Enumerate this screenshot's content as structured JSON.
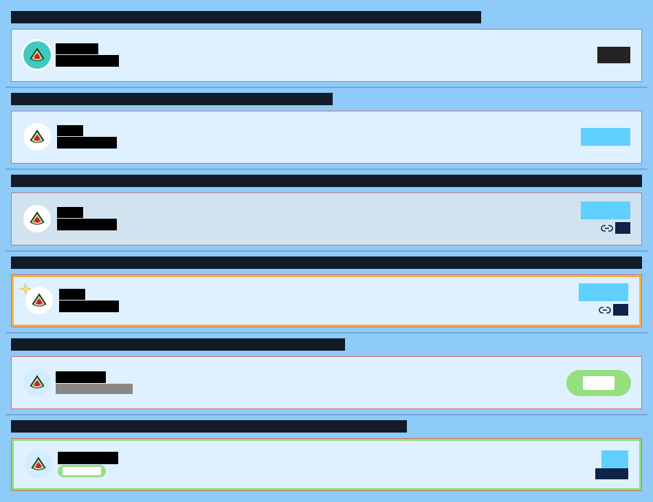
{
  "sections": [
    {
      "title": ""
    },
    {
      "title": ""
    },
    {
      "title": ""
    },
    {
      "title": ""
    },
    {
      "title": ""
    },
    {
      "title": ""
    }
  ],
  "cards": [
    {
      "name": "",
      "subtitle": "",
      "action": ""
    },
    {
      "name": "",
      "subtitle": "",
      "action": ""
    },
    {
      "name": "",
      "subtitle": "",
      "action": "",
      "link": ""
    },
    {
      "name": "",
      "subtitle": "",
      "action": "",
      "link": ""
    },
    {
      "name": "",
      "subtitle": "",
      "action": ""
    },
    {
      "name": "",
      "badge": "",
      "action": "",
      "secondary": ""
    }
  ],
  "icons": {
    "avatar": "watermelon-icon",
    "link": "link-icon",
    "sparkle": "sparkle-icon"
  },
  "colors": {
    "page_background": "#8ecbf8",
    "card_background": "#dff0ff",
    "card_border": "#d86a74",
    "accent_cyan": "#60d0ff",
    "accent_navy": "#0d2448",
    "accent_green": "#95df7f",
    "highlight_gold": "#f3b340",
    "teal_avatar": "#40c9c1"
  }
}
